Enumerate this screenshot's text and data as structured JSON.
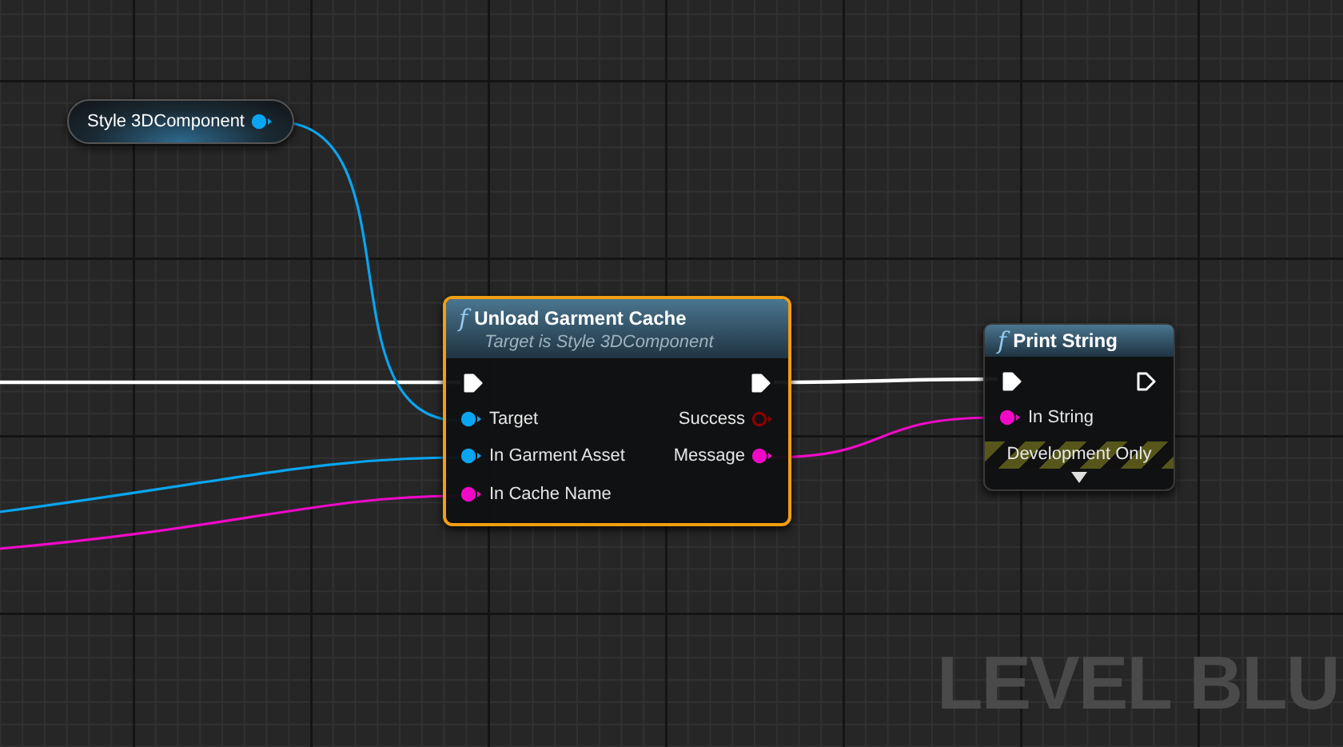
{
  "nodes": [
    {
      "kind": "variable",
      "title": "Style 3DComponent",
      "outputs": [
        {
          "kind": "object",
          "connected": true
        }
      ]
    },
    {
      "kind": "function",
      "icon": "f",
      "title": "Unload Garment Cache",
      "subtitle": "Target is Style 3DComponent",
      "selected": true,
      "exec_in": {
        "connected": true
      },
      "exec_out": {
        "connected": true
      },
      "inputs": [
        {
          "label": "Target",
          "kind": "object",
          "connected": true
        },
        {
          "label": "In Garment Asset",
          "kind": "object",
          "connected": true
        },
        {
          "label": "In Cache Name",
          "kind": "string",
          "connected": true
        }
      ],
      "outputs": [
        {
          "label": "Success",
          "kind": "bool",
          "connected": false
        },
        {
          "label": "Message",
          "kind": "string",
          "connected": true
        }
      ]
    },
    {
      "kind": "function",
      "icon": "f",
      "title": "Print String",
      "selected": false,
      "exec_in": {
        "connected": true
      },
      "exec_out": {
        "connected": false
      },
      "inputs": [
        {
          "label": "In String",
          "kind": "string",
          "connected": true
        }
      ],
      "development_only": "Development Only"
    }
  ],
  "graph_label": "LEVEL BLU"
}
